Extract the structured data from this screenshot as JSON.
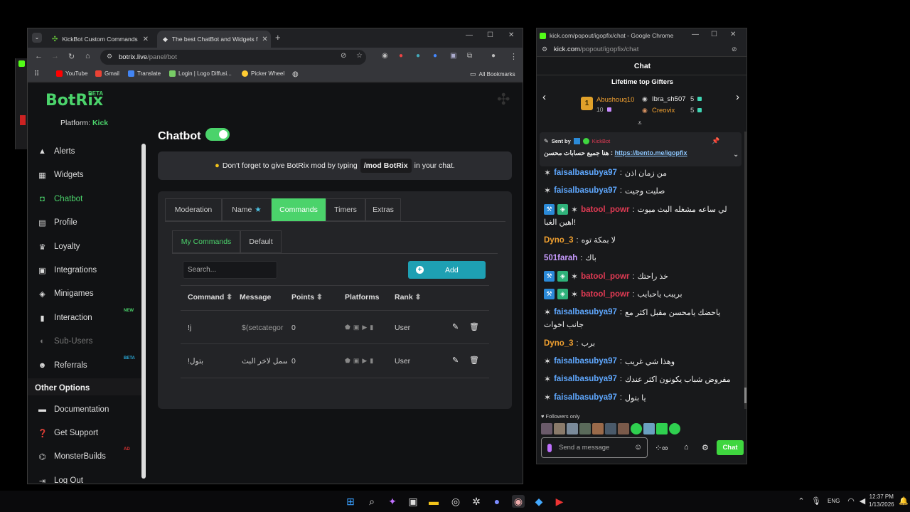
{
  "browser_left": {
    "tabs": [
      {
        "label": "KickBot Custom Commands",
        "active": false
      },
      {
        "label": "The best ChatBot and Widgets f",
        "active": true
      }
    ],
    "url_host": "botrix.live",
    "url_path": "/panel/bot",
    "bookmarks": [
      "YouTube",
      "Gmail",
      "Translate",
      "Login | Logo Diffusi...",
      "Picker Wheel"
    ],
    "all_bookmarks": "All Bookmarks"
  },
  "botrix": {
    "brand": "BotRix",
    "beta": "BETA",
    "platform_label": "Platform:",
    "platform_value": "Kick",
    "nav": [
      {
        "label": "Alerts",
        "icon": "warning-icon"
      },
      {
        "label": "Widgets",
        "icon": "grid-icon"
      },
      {
        "label": "Chatbot",
        "icon": "robot-icon",
        "active": true
      },
      {
        "label": "Profile",
        "icon": "id-card-icon"
      },
      {
        "label": "Loyalty",
        "icon": "trophy-icon"
      },
      {
        "label": "Integrations",
        "icon": "integrations-icon"
      },
      {
        "label": "Minigames",
        "icon": "gamepad-icon"
      },
      {
        "label": "Interaction",
        "icon": "film-icon",
        "badge": "NEW"
      },
      {
        "label": "Sub-Users",
        "icon": "sub-users-icon",
        "disabled": true
      },
      {
        "label": "Referrals",
        "icon": "users-icon",
        "badge": "BETA"
      }
    ],
    "other_header": "Other Options",
    "other": [
      {
        "label": "Documentation",
        "icon": "document-icon"
      },
      {
        "label": "Get Support",
        "icon": "help-icon"
      },
      {
        "label": "MonsterBuilds",
        "icon": "monster-icon",
        "badge": "AD"
      },
      {
        "label": "Log Out",
        "icon": "logout-icon"
      }
    ],
    "page_title": "Chatbot",
    "notice_pre": "Don't forget to give BotRix mod by typing",
    "notice_code": "/mod BotRix",
    "notice_post": "in your chat.",
    "tabs": [
      "Moderation",
      "Name",
      "Commands",
      "Timers",
      "Extras"
    ],
    "active_tab": "Commands",
    "subtabs": [
      "My Commands",
      "Default"
    ],
    "search_placeholder": "Search...",
    "add_label": "Add",
    "columns": [
      "Command",
      "Message",
      "Points",
      "Platforms",
      "Rank"
    ],
    "rows": [
      {
        "command": "!j",
        "message": "$(setcategor",
        "points": "0",
        "rank": "User"
      },
      {
        "command": "!بتول",
        "message": "يسمل لاخر البث",
        "points": "0",
        "rank": "User"
      }
    ]
  },
  "chat_window": {
    "title": "kick.com/popout/igopfix/chat - Google Chrome",
    "url_host": "kick.com",
    "url_path": "/popout/igopfix/chat",
    "header": "Chat",
    "gifters_title": "Lifetime top Gifters",
    "gifters": [
      {
        "rank": "1",
        "name": "Abushouq10",
        "count": "10"
      },
      {
        "name": "Ibra_sh507",
        "count": "5"
      },
      {
        "name": "Creovix",
        "count": "5"
      }
    ],
    "pinned_sent_by": "Sent by",
    "pinned_user": "KickBot",
    "pinned_text": "هنا جميع حسابات محسن :",
    "pinned_link": "https://bento.me/igopfix",
    "messages": [
      {
        "user": "faisalbasubya97",
        "cls": "u1",
        "text": "من زمان اذن"
      },
      {
        "user": "faisalbasubya97",
        "cls": "u1",
        "text": "صليت وجيت"
      },
      {
        "user": "batool_powr",
        "cls": "u2",
        "text": "لي ساعه مشغله البث ميوت",
        "text2": "اهين الغبا!"
      },
      {
        "user": "Dyno_3",
        "cls": "u3",
        "text": "لا بمكة توه"
      },
      {
        "user": "501farah",
        "cls": "u4",
        "text": "باك"
      },
      {
        "user": "batool_powr",
        "cls": "u2",
        "text": "خذ راحتك"
      },
      {
        "user": "batool_powr",
        "cls": "u2",
        "text": "بريبب ياحبايب"
      },
      {
        "user": "faisalbasubya97",
        "cls": "u1",
        "text": "ياحضك يامحسن مقبل اكثر مع",
        "text2": "جانب اخوات"
      },
      {
        "user": "Dyno_3",
        "cls": "u3",
        "text": "برب"
      },
      {
        "user": "faisalbasubya97",
        "cls": "u1",
        "text": "وهذا شي غريب"
      },
      {
        "user": "faisalbasubya97",
        "cls": "u1",
        "text": "مفروض شباب يكونون اكثر عندك"
      },
      {
        "user": "faisalbasubya97",
        "cls": "u1",
        "text": "يا بتول"
      }
    ],
    "followers_only": "Followers only",
    "send_placeholder": "Send a message",
    "chat_button": "Chat"
  },
  "taskbar": {
    "lang": "ENG",
    "time": "12:37 PM",
    "date": "1/13/2026"
  }
}
